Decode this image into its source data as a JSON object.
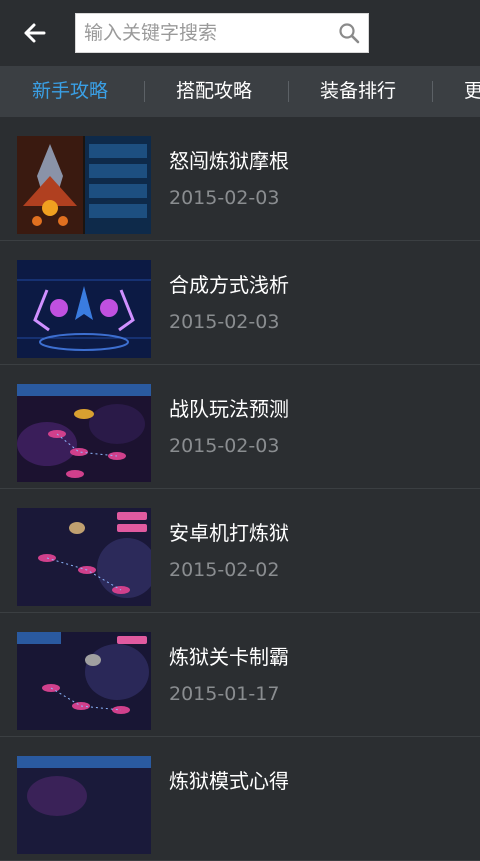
{
  "header": {
    "back_icon": "arrow-left-icon",
    "search_placeholder": "输入关键字搜索",
    "search_icon": "search-icon"
  },
  "tabs": [
    {
      "label": "新手攻略",
      "active": true
    },
    {
      "label": "搭配攻略",
      "active": false
    },
    {
      "label": "装备排行",
      "active": false
    },
    {
      "label": "更",
      "active": false
    }
  ],
  "colors": {
    "accent": "#3aa0e6",
    "background": "#2b2e31",
    "tabbar": "#3b3f43"
  },
  "articles": [
    {
      "title": "怒闯炼狱摩根",
      "date": "2015-02-03"
    },
    {
      "title": "合成方式浅析",
      "date": "2015-02-03"
    },
    {
      "title": "战队玩法预测",
      "date": "2015-02-03"
    },
    {
      "title": "安卓机打炼狱",
      "date": "2015-02-02"
    },
    {
      "title": "炼狱关卡制霸",
      "date": "2015-01-17"
    },
    {
      "title": "炼狱模式心得",
      "date": ""
    }
  ]
}
